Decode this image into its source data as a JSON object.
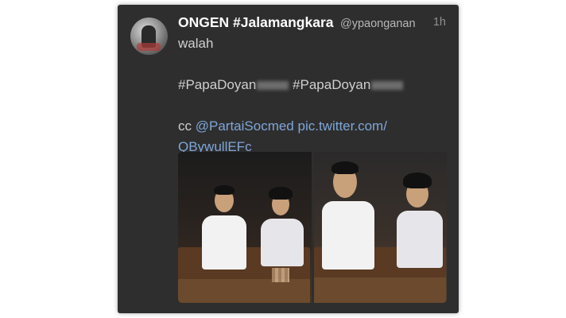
{
  "tweet": {
    "display_name": "ONGEN #Jalamangkara",
    "handle": "@ypaonganan",
    "timestamp": "1h",
    "text_line1": "walah",
    "hashtag_1": "#PapaDoyan",
    "hashtag_2": "#PapaDoyan",
    "cc_prefix": "cc",
    "mention": "@PartaiSocmed",
    "pic_link_part1": "pic.twitter.com/",
    "pic_link_part2": "QBywullEFc"
  },
  "icons": {
    "avatar": "user-avatar",
    "media": "photo-collage"
  },
  "colors": {
    "card_bg": "#2e2e2e",
    "name": "#ffffff",
    "handle": "#b7b7b7",
    "body_text": "#cfcfcf",
    "link": "#7ea6d8"
  }
}
